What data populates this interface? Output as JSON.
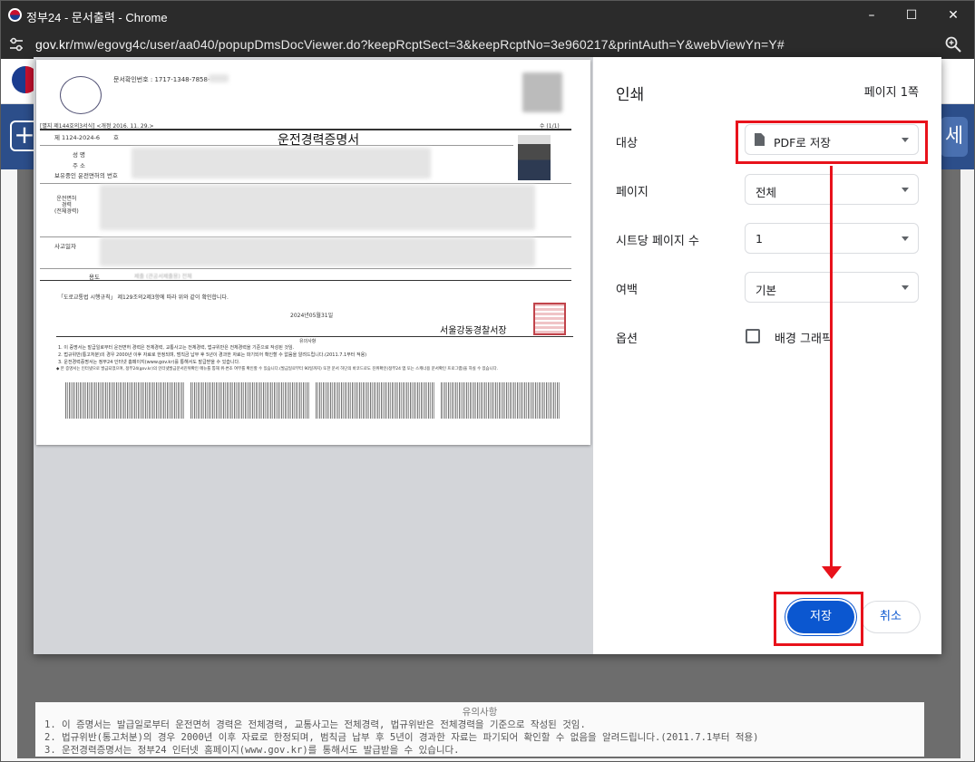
{
  "window": {
    "title": "정부24 - 문서출력 - Chrome",
    "minimize": "–",
    "maximize": "☐",
    "close": "✕"
  },
  "address": {
    "domain": "gov.kr",
    "path": "/mw/egovg4c/user/aa040/popupDmsDocViewer.do?keepRcptSect=3&keepRcptNo=3e960217&printAuth=Y&webViewYn=Y#"
  },
  "site": {
    "plus": "+",
    "right_tab": "세"
  },
  "document": {
    "confirm_no": "문서확인번호 : 1717-1348-7858-",
    "form_ref": "[별지 제144호의3서식] <개정 2016. 11. 29.>",
    "page_ind": "수 (1/1)",
    "doc_no": "제 1124-2024-6",
    "doc_no_suffix": "호",
    "doc_title": "운전경력증명서",
    "f_name": "성    명",
    "f_addr": "주    소",
    "f_license": "보유중인 운전면허의 번호",
    "f_career": "운전면허\n경력\n(전체경력)",
    "f_accident": "사고일자",
    "f_usage": "용도",
    "usage_val": "제출 (관공서제출용) 전체",
    "legal": "「도로교통법 시행규칙」 제129조의2제3항에 따라 위와 같이 확인합니다.",
    "date": "2024년05월31일",
    "issuer": "서울강동경찰서장",
    "notes_head": "유의사항",
    "note1": "1. 이 증명서는 발급일로부터 운전면허 경력은 전체경력, 교통사고는 전체경력, 법규위반은 전체경력을 기준으로 작성된 것임.",
    "note2": "2. 법규위반(통고처분)의 경우 2000년 이후 자료로  한정되며, 범칙금 납부 후 5년이 경과한 자료는 파기되어 확인할 수 없음을 알려드립니다.(2011.7.1부터 적용)",
    "note3": "3. 운전경력증명서는 정부24 인터넷 홈페이지(www.gov.kr)를 통해서도 발급받을 수 있습니다.",
    "note4": "◆ 본 증명서는 인터넷으로 발급되었으며, 정부24(gov.kr)의 인터넷발급문서진위확인 메뉴를 통해 위·변조 여부를 확인할 수 있습니다.(발급일로부터 90일까지) 또한 문서 하단의 바코드로도 진위확인(정부24 앱 또는 스캐너용 문서확인 프로그램)을 하실 수 있습니다.",
    "note4b": "앱 또는 스캐너용 문서확인 프로그램)을 하실 수 있습니다."
  },
  "print_panel": {
    "title": "인쇄",
    "page_count": "페이지 1쪽",
    "destination_label": "대상",
    "destination_value": "PDF로 저장",
    "pages_label": "페이지",
    "pages_value": "전체",
    "pps_label": "시트당 페이지 수",
    "pps_value": "1",
    "margins_label": "여백",
    "margins_value": "기본",
    "options_label": "옵션",
    "bg_graphics_label": "배경 그래픽",
    "save_button": "저장",
    "cancel_button": "취소"
  },
  "colors": {
    "accent": "#0b57d0",
    "highlight": "#e8121b",
    "site_blue": "#2c4e8a"
  }
}
